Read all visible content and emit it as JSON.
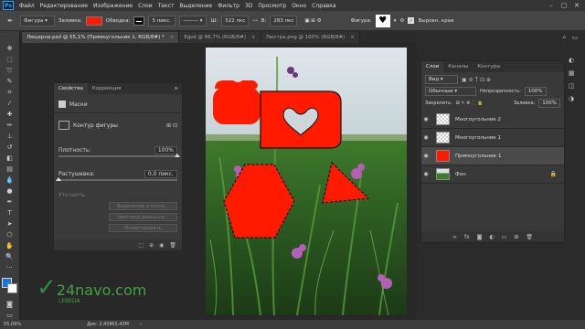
{
  "app": {
    "logo": "Ps"
  },
  "menu": [
    "Файл",
    "Редактирование",
    "Изображение",
    "Слои",
    "Текст",
    "Выделение",
    "Фильтр",
    "3D",
    "Просмотр",
    "Окно",
    "Справка"
  ],
  "options": {
    "mode": "Фигура",
    "fill_label": "Заливка:",
    "fill_color": "#ff1a00",
    "stroke_label": "Обводка:",
    "stroke_width": "5 пикс.",
    "w_label": "Ш:",
    "w_value": "522 пкс",
    "h_label": "В:",
    "h_value": "283 пкс",
    "shape_label": "Фигура:",
    "align_label": "Выровн. края"
  },
  "doc_tabs": [
    {
      "label": "Люцерна.psd @ 55,1% (Прямоугольник 1, RGB/8#) *",
      "active": true
    },
    {
      "label": "Egsd @ 66,7% (RGB/8#)",
      "active": false
    },
    {
      "label": "Люстрa.png @ 100% (RGB/8#)",
      "active": false
    }
  ],
  "tool_color_fg": "#1473e6",
  "tool_color_bg": "#ffffff",
  "properties": {
    "tab1": "Свойства",
    "tab2": "Коррекция",
    "masks_label": "Маски",
    "shape_contour": "Контур фигуры",
    "density_label": "Плотность:",
    "density_value": "100%",
    "density_level": 100,
    "feather_label": "Растушевка:",
    "feather_value": "0,0 пикс.",
    "feather_level": 0,
    "refine_label": "Уточнить:",
    "btn_select": "Выделение и маска...",
    "btn_color": "Цветовой диапазон...",
    "btn_invert": "Инвертировать"
  },
  "layers_panel": {
    "tabs": [
      "Слои",
      "Каналы",
      "Контуры"
    ],
    "kind": "Вид",
    "blend": "Обычные",
    "opacity_label": "Непрозрачность:",
    "opacity_value": "100%",
    "lock_label": "Закрепить:",
    "fill_label": "Заливка:",
    "fill_value": "100%",
    "layers": [
      {
        "name": "Многоугольник 2",
        "selected": false
      },
      {
        "name": "Многоугольник 1",
        "selected": false
      },
      {
        "name": "Прямоугольник 1",
        "selected": true
      },
      {
        "name": "Фон",
        "selected": false
      }
    ]
  },
  "status": {
    "zoom": "55,09%",
    "doc": "Док: 2,43M/2,43M"
  },
  "watermark": {
    "brand": "24navo.com",
    "sub": "LEBEDA"
  }
}
